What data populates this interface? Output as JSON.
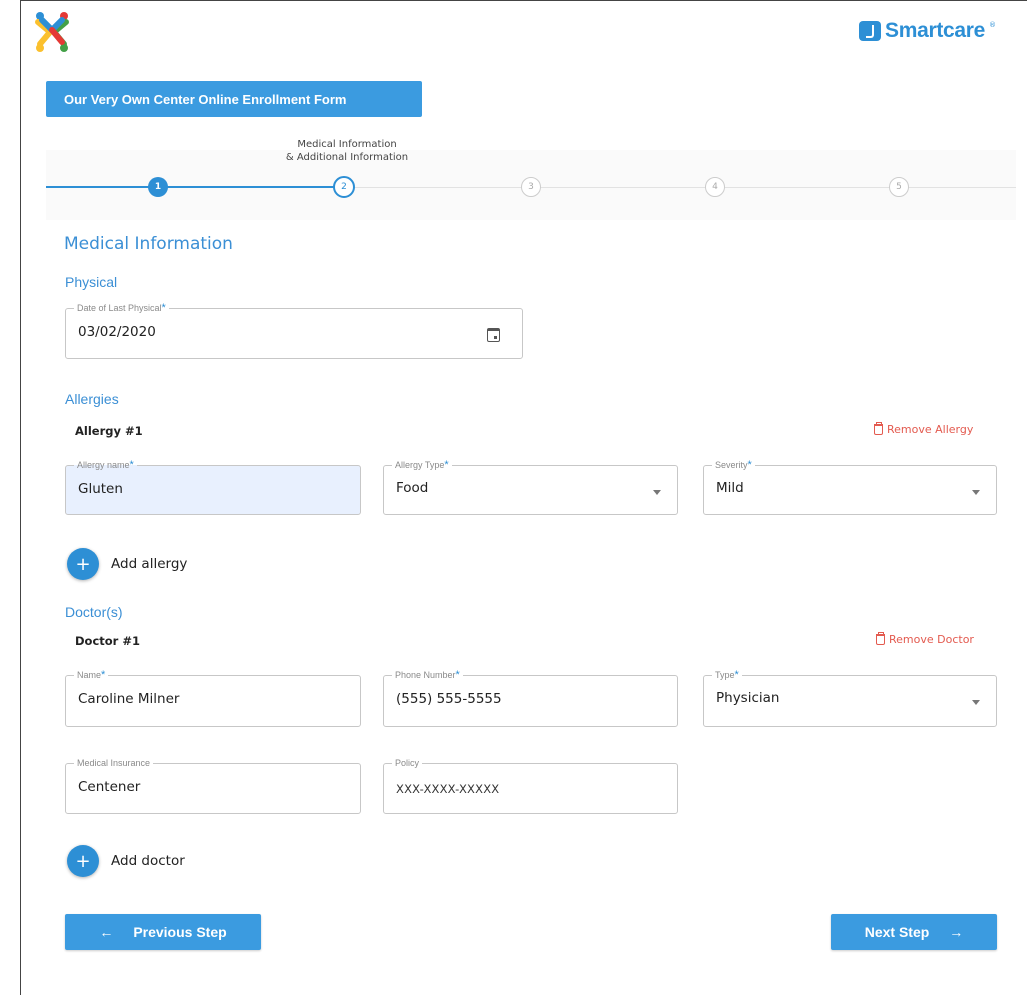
{
  "brand": {
    "name": "Smartcare",
    "tm": "®"
  },
  "form_title": "Our Very Own Center Online Enrollment Form",
  "stepper": {
    "caption_line1": "Medical Information",
    "caption_line2": "& Additional Information",
    "steps": [
      "1",
      "2",
      "3",
      "4",
      "5"
    ],
    "accent": "#2d8fd5"
  },
  "section_title": "Medical Information",
  "physical": {
    "heading": "Physical",
    "date_label": "Date of Last Physical",
    "date_value": "03/02/2020"
  },
  "allergies": {
    "heading": "Allergies",
    "item_title": "Allergy #1",
    "remove_label": "Remove Allergy",
    "name_label": "Allergy name",
    "name_value": "Gluten",
    "type_label": "Allergy Type",
    "type_value": "Food",
    "severity_label": "Severity",
    "severity_value": "Mild",
    "add_label": "Add allergy"
  },
  "doctors": {
    "heading": "Doctor(s)",
    "item_title": "Doctor #1",
    "remove_label": "Remove Doctor",
    "name_label": "Name",
    "name_value": "Caroline Milner",
    "phone_label": "Phone Number",
    "phone_value": "(555) 555-5555",
    "type_label": "Type",
    "type_value": "Physician",
    "insurance_label": "Medical Insurance",
    "insurance_value": "Centener",
    "policy_label": "Policy",
    "policy_value": "XXX-XXXX-XXXXX",
    "add_label": "Add doctor"
  },
  "required_mark": "*",
  "nav": {
    "prev_label": "Previous Step",
    "next_label": "Next Step",
    "prev_icon": "arrow-left-icon",
    "next_icon": "arrow-right-icon"
  },
  "colors": {
    "primary": "#3b9be0",
    "danger": "#e35a4f",
    "autofill": "#e8f0fe"
  }
}
